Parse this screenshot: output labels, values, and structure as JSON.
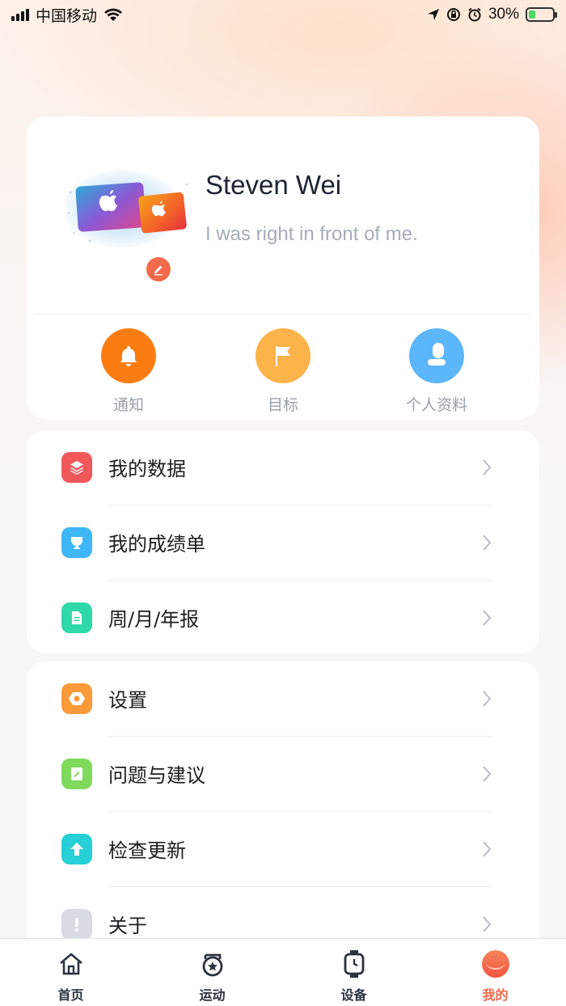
{
  "status_bar": {
    "carrier": "中国移动",
    "battery_percent": "30%",
    "battery_level": 0.3
  },
  "profile": {
    "name": "Steven Wei",
    "bio": "I was right in front of me.",
    "avatar_icon": "apple-gift-cards-image",
    "edit_icon": "pencil-icon"
  },
  "quick_actions": [
    {
      "label": "通知",
      "icon": "bell-icon",
      "color": "#fb7d12"
    },
    {
      "label": "目标",
      "icon": "flag-icon",
      "color": "#fcb34a"
    },
    {
      "label": "个人资料",
      "icon": "person-icon",
      "color": "#5cb6fb"
    }
  ],
  "menu_group_1": [
    {
      "label": "我的数据",
      "icon": "layers-icon",
      "color": "#f0585a"
    },
    {
      "label": "我的成绩单",
      "icon": "trophy-icon",
      "color": "#3fb6f5"
    },
    {
      "label": "周/月/年报",
      "icon": "document-icon",
      "color": "#2fd8a8"
    }
  ],
  "menu_group_2": [
    {
      "label": "设置",
      "icon": "hexagon-gear-icon",
      "color": "#fb9a39"
    },
    {
      "label": "问题与建议",
      "icon": "note-edit-icon",
      "color": "#7fd95b"
    },
    {
      "label": "检查更新",
      "icon": "arrow-up-icon",
      "color": "#27cfd6"
    },
    {
      "label": "关于",
      "icon": "exclamation-icon",
      "color": "#d8dbe2"
    }
  ],
  "tabs": [
    {
      "label": "首页",
      "icon": "home-icon",
      "active": false
    },
    {
      "label": "运动",
      "icon": "sport-star-icon",
      "active": false
    },
    {
      "label": "设备",
      "icon": "watch-icon",
      "active": false
    },
    {
      "label": "我的",
      "icon": "profile-circle-icon",
      "active": true
    }
  ],
  "colors": {
    "accent": "#f36a4c",
    "text_muted": "#a6adb7"
  }
}
